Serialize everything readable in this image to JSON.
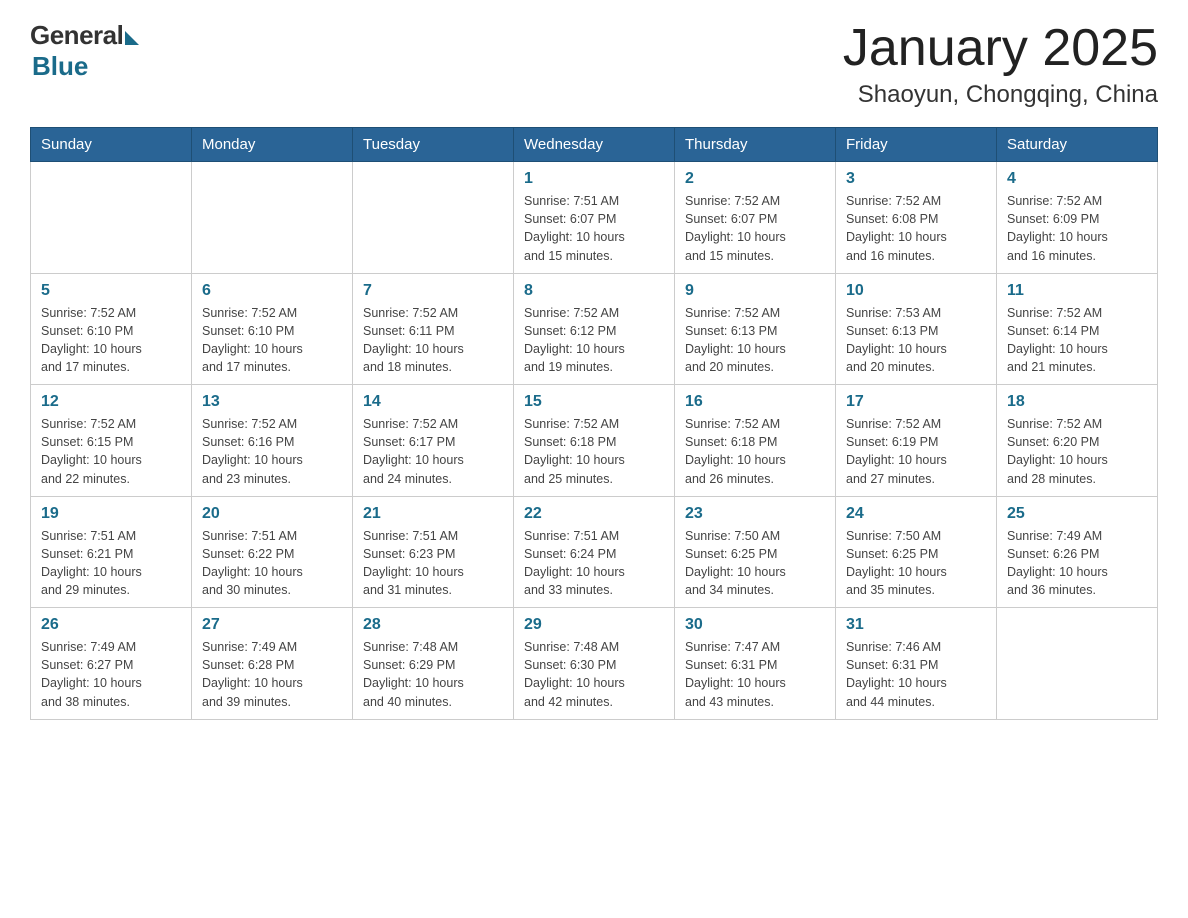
{
  "logo": {
    "general": "General",
    "blue": "Blue"
  },
  "title": "January 2025",
  "subtitle": "Shaoyun, Chongqing, China",
  "headers": [
    "Sunday",
    "Monday",
    "Tuesday",
    "Wednesday",
    "Thursday",
    "Friday",
    "Saturday"
  ],
  "weeks": [
    [
      {
        "num": "",
        "info": ""
      },
      {
        "num": "",
        "info": ""
      },
      {
        "num": "",
        "info": ""
      },
      {
        "num": "1",
        "info": "Sunrise: 7:51 AM\nSunset: 6:07 PM\nDaylight: 10 hours\nand 15 minutes."
      },
      {
        "num": "2",
        "info": "Sunrise: 7:52 AM\nSunset: 6:07 PM\nDaylight: 10 hours\nand 15 minutes."
      },
      {
        "num": "3",
        "info": "Sunrise: 7:52 AM\nSunset: 6:08 PM\nDaylight: 10 hours\nand 16 minutes."
      },
      {
        "num": "4",
        "info": "Sunrise: 7:52 AM\nSunset: 6:09 PM\nDaylight: 10 hours\nand 16 minutes."
      }
    ],
    [
      {
        "num": "5",
        "info": "Sunrise: 7:52 AM\nSunset: 6:10 PM\nDaylight: 10 hours\nand 17 minutes."
      },
      {
        "num": "6",
        "info": "Sunrise: 7:52 AM\nSunset: 6:10 PM\nDaylight: 10 hours\nand 17 minutes."
      },
      {
        "num": "7",
        "info": "Sunrise: 7:52 AM\nSunset: 6:11 PM\nDaylight: 10 hours\nand 18 minutes."
      },
      {
        "num": "8",
        "info": "Sunrise: 7:52 AM\nSunset: 6:12 PM\nDaylight: 10 hours\nand 19 minutes."
      },
      {
        "num": "9",
        "info": "Sunrise: 7:52 AM\nSunset: 6:13 PM\nDaylight: 10 hours\nand 20 minutes."
      },
      {
        "num": "10",
        "info": "Sunrise: 7:53 AM\nSunset: 6:13 PM\nDaylight: 10 hours\nand 20 minutes."
      },
      {
        "num": "11",
        "info": "Sunrise: 7:52 AM\nSunset: 6:14 PM\nDaylight: 10 hours\nand 21 minutes."
      }
    ],
    [
      {
        "num": "12",
        "info": "Sunrise: 7:52 AM\nSunset: 6:15 PM\nDaylight: 10 hours\nand 22 minutes."
      },
      {
        "num": "13",
        "info": "Sunrise: 7:52 AM\nSunset: 6:16 PM\nDaylight: 10 hours\nand 23 minutes."
      },
      {
        "num": "14",
        "info": "Sunrise: 7:52 AM\nSunset: 6:17 PM\nDaylight: 10 hours\nand 24 minutes."
      },
      {
        "num": "15",
        "info": "Sunrise: 7:52 AM\nSunset: 6:18 PM\nDaylight: 10 hours\nand 25 minutes."
      },
      {
        "num": "16",
        "info": "Sunrise: 7:52 AM\nSunset: 6:18 PM\nDaylight: 10 hours\nand 26 minutes."
      },
      {
        "num": "17",
        "info": "Sunrise: 7:52 AM\nSunset: 6:19 PM\nDaylight: 10 hours\nand 27 minutes."
      },
      {
        "num": "18",
        "info": "Sunrise: 7:52 AM\nSunset: 6:20 PM\nDaylight: 10 hours\nand 28 minutes."
      }
    ],
    [
      {
        "num": "19",
        "info": "Sunrise: 7:51 AM\nSunset: 6:21 PM\nDaylight: 10 hours\nand 29 minutes."
      },
      {
        "num": "20",
        "info": "Sunrise: 7:51 AM\nSunset: 6:22 PM\nDaylight: 10 hours\nand 30 minutes."
      },
      {
        "num": "21",
        "info": "Sunrise: 7:51 AM\nSunset: 6:23 PM\nDaylight: 10 hours\nand 31 minutes."
      },
      {
        "num": "22",
        "info": "Sunrise: 7:51 AM\nSunset: 6:24 PM\nDaylight: 10 hours\nand 33 minutes."
      },
      {
        "num": "23",
        "info": "Sunrise: 7:50 AM\nSunset: 6:25 PM\nDaylight: 10 hours\nand 34 minutes."
      },
      {
        "num": "24",
        "info": "Sunrise: 7:50 AM\nSunset: 6:25 PM\nDaylight: 10 hours\nand 35 minutes."
      },
      {
        "num": "25",
        "info": "Sunrise: 7:49 AM\nSunset: 6:26 PM\nDaylight: 10 hours\nand 36 minutes."
      }
    ],
    [
      {
        "num": "26",
        "info": "Sunrise: 7:49 AM\nSunset: 6:27 PM\nDaylight: 10 hours\nand 38 minutes."
      },
      {
        "num": "27",
        "info": "Sunrise: 7:49 AM\nSunset: 6:28 PM\nDaylight: 10 hours\nand 39 minutes."
      },
      {
        "num": "28",
        "info": "Sunrise: 7:48 AM\nSunset: 6:29 PM\nDaylight: 10 hours\nand 40 minutes."
      },
      {
        "num": "29",
        "info": "Sunrise: 7:48 AM\nSunset: 6:30 PM\nDaylight: 10 hours\nand 42 minutes."
      },
      {
        "num": "30",
        "info": "Sunrise: 7:47 AM\nSunset: 6:31 PM\nDaylight: 10 hours\nand 43 minutes."
      },
      {
        "num": "31",
        "info": "Sunrise: 7:46 AM\nSunset: 6:31 PM\nDaylight: 10 hours\nand 44 minutes."
      },
      {
        "num": "",
        "info": ""
      }
    ]
  ]
}
